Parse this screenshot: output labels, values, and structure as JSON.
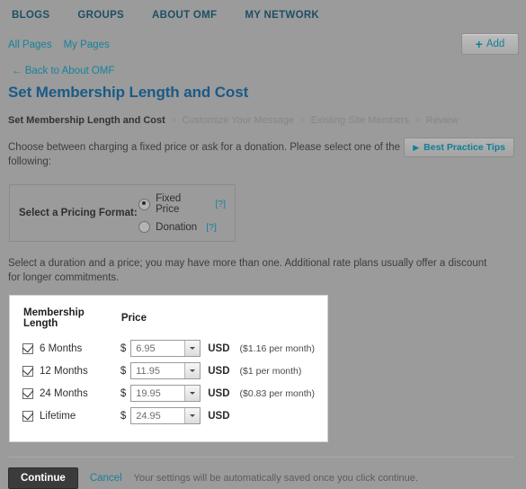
{
  "topnav": {
    "items": [
      {
        "label": "BLOGS"
      },
      {
        "label": "GROUPS"
      },
      {
        "label": "ABOUT OMF"
      },
      {
        "label": "MY NETWORK"
      }
    ]
  },
  "subnav": {
    "links": [
      {
        "label": "All Pages"
      },
      {
        "label": "My Pages"
      }
    ],
    "add_plus": "+",
    "add_label": "Add"
  },
  "page": {
    "back_link": "← Back to About OMF",
    "title": "Set Membership Length and Cost"
  },
  "steps": {
    "current": "Set Membership Length and Cost",
    "separator": ">",
    "next": [
      {
        "label": "Customize Your Message"
      },
      {
        "label": "Existing Site Members"
      },
      {
        "label": "Review"
      }
    ]
  },
  "intro": {
    "text": "Choose between charging a fixed price or ask for a donation. Please select one of the following:",
    "tips_arrow": "▶",
    "tips_label": "Best Practice Tips"
  },
  "pricing_format": {
    "label": "Select a Pricing Format:",
    "options": [
      {
        "label": "Fixed Price",
        "selected": true,
        "help": "[?]"
      },
      {
        "label": "Donation",
        "selected": false,
        "help": "[?]"
      }
    ]
  },
  "duration_note": "Select a duration and a price; you may have more than one. Additional rate plans usually offer a discount for longer commitments.",
  "price_table": {
    "headers": {
      "length": "Membership Length",
      "price": "Price"
    },
    "currency_symbol": "$",
    "rows": [
      {
        "checked": true,
        "length": "6 Months",
        "price": "6.95",
        "currency": "USD",
        "per_month": "($1.16 per month)"
      },
      {
        "checked": true,
        "length": "12 Months",
        "price": "11.95",
        "currency": "USD",
        "per_month": "($1 per month)"
      },
      {
        "checked": true,
        "length": "24 Months",
        "price": "19.95",
        "currency": "USD",
        "per_month": "($0.83 per month)"
      },
      {
        "checked": true,
        "length": "Lifetime",
        "price": "24.95",
        "currency": "USD",
        "per_month": ""
      }
    ]
  },
  "footer": {
    "continue_label": "Continue",
    "cancel_label": "Cancel",
    "note": "Your settings will be automatically saved once you click continue."
  },
  "colors": {
    "page_background": "#9b9b9b",
    "nav_text": "#1d4f63",
    "link_teal": "#17829b",
    "title_blue": "#1a5a86",
    "panel_white": "#ffffff",
    "continue_dark": "#3b3b3b"
  }
}
